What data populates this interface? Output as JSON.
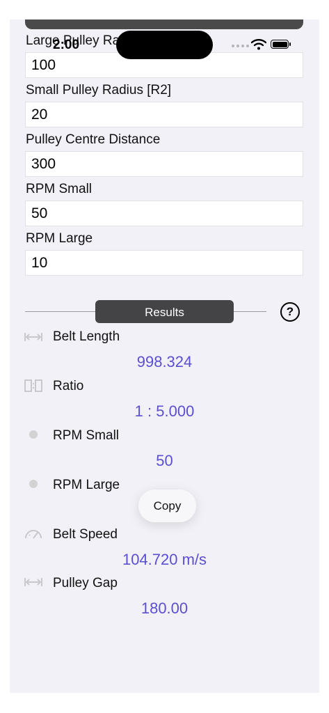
{
  "status_bar": {
    "time": "2:00"
  },
  "inputs": [
    {
      "label": "Large Pulley Ra",
      "value": "100"
    },
    {
      "label": "Small Pulley Radius [R2]",
      "value": "20"
    },
    {
      "label": "Pulley Centre Distance",
      "value": "300"
    },
    {
      "label": "RPM Small",
      "value": "50"
    },
    {
      "label": "RPM Large",
      "value": "10"
    }
  ],
  "results_button": "Results",
  "help_label": "?",
  "results": [
    {
      "label": "Belt Length",
      "value": "998.324",
      "icon": "length-arrows-icon"
    },
    {
      "label": "Ratio",
      "value": "1 : 5.000",
      "icon": "ratio-icon"
    },
    {
      "label": "RPM Small",
      "value": "50",
      "icon": "dot-icon"
    },
    {
      "label": "RPM Large",
      "value": "",
      "icon": "dot-icon"
    },
    {
      "label": "Belt Speed",
      "value": "104.720 m/s",
      "icon": "speedometer-icon"
    },
    {
      "label": "Pulley Gap",
      "value": "180.00",
      "icon": "length-arrows-icon"
    }
  ],
  "context_menu": {
    "copy_label": "Copy"
  },
  "colors": {
    "accent": "#5b4fd1",
    "background": "#f2f1f7",
    "button": "#444446"
  }
}
